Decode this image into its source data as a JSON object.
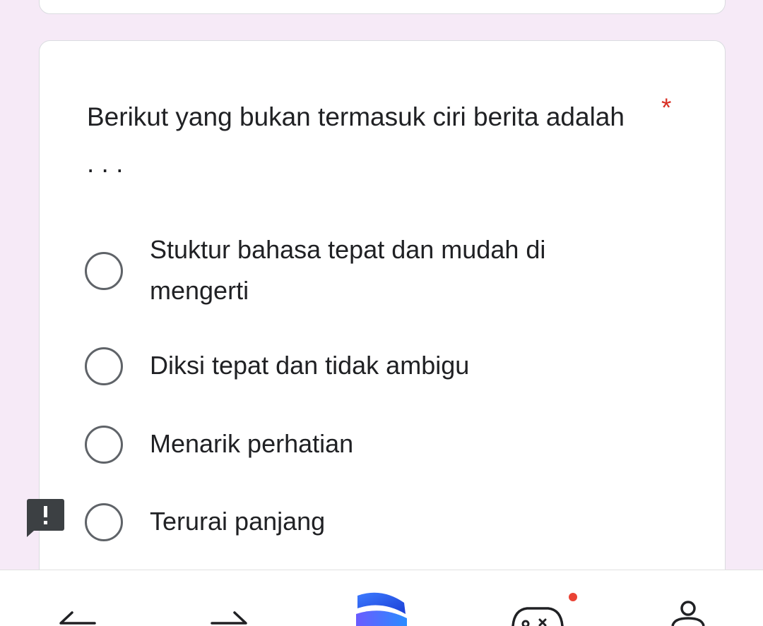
{
  "form": {
    "question": {
      "text": "Berikut yang bukan termasuk ciri berita adalah . . .",
      "required_mark": "*"
    },
    "options": [
      {
        "label_lines": [
          "Stuktur bahasa tepat dan mudah di",
          "mengerti"
        ],
        "selected": false
      },
      {
        "label_lines": [
          "Diksi tepat dan tidak ambigu"
        ],
        "selected": false
      },
      {
        "label_lines": [
          "Menarik perhatian"
        ],
        "selected": false
      },
      {
        "label_lines": [
          "Terurai panjang"
        ],
        "selected": false
      }
    ]
  },
  "feedback_button": {
    "icon": "report-issue-icon"
  },
  "bottom_nav": {
    "items": [
      {
        "icon": "back-arrow-icon"
      },
      {
        "icon": "forward-arrow-icon"
      },
      {
        "icon": "app-logo-icon"
      },
      {
        "icon": "game-controller-icon",
        "badge_color": "#ea4335"
      },
      {
        "icon": "profile-icon"
      }
    ]
  },
  "colors": {
    "page_background": "#f6eaf7",
    "card_background": "#ffffff",
    "required": "#d93025",
    "radio_border": "#5f6368",
    "feedback_badge": "#3c4043"
  }
}
